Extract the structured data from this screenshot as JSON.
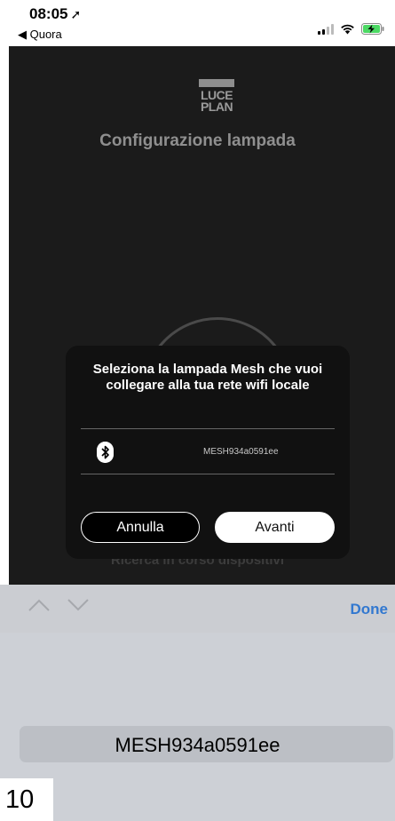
{
  "status_bar": {
    "time": "08:05",
    "location_arrow": "➚",
    "back_label": "◀ Quora",
    "icons": [
      "signal-icon",
      "wifi-icon",
      "battery-charging-icon"
    ]
  },
  "app": {
    "logo_line1": "LUCE",
    "logo_line2": "PLAN",
    "title": "Configurazione lampada",
    "status_text": "Ricerca in corso dispositivi"
  },
  "dialog": {
    "message": "Seleziona la lampada Mesh che vuoi collegare alla tua rete wifi locale",
    "device_icon": "bluetooth-icon",
    "device_name": "MESH934a0591ee",
    "cancel_label": "Annulla",
    "next_label": "Avanti"
  },
  "accessory_bar": {
    "done_label": "Done"
  },
  "picker": {
    "selected_value": "MESH934a0591ee"
  },
  "page_number": "10",
  "colors": {
    "app_background": "#1b1b1b",
    "dialog_background": "#111111",
    "done_blue": "#3278d0",
    "picker_background": "#cdd0d6"
  }
}
